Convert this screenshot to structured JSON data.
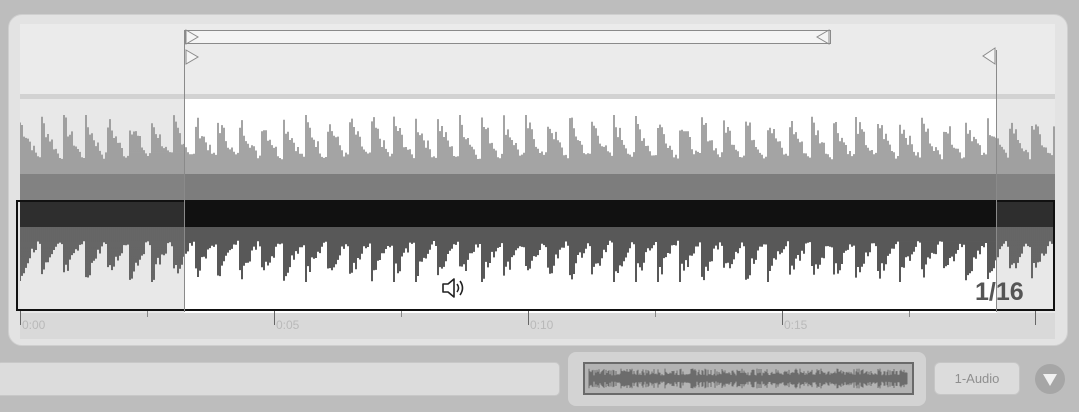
{
  "clip": {
    "time_ruler": {
      "labels": [
        "0:00",
        "0:05",
        "0:10",
        "0:15"
      ]
    },
    "grid_label": "1/16"
  },
  "bottom_bar": {
    "track_button_label": "1-Audio"
  },
  "icons": {
    "preview_speaker": "speaker-icon",
    "expand_toggle": "triangle-down-icon",
    "loop_start_marker": "triangle-right-marker-icon",
    "loop_end_marker": "triangle-left-marker-icon"
  },
  "colors": {
    "waveform_top": "#7d7d7d",
    "waveform_bottom": "#111111",
    "panel_bg": "#e3e3e3"
  }
}
